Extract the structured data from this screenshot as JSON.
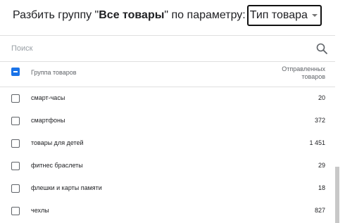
{
  "header": {
    "prefix": "Разбить группу \"",
    "group": "Все товары",
    "suffix": "\" по параметру:",
    "dropdown_value": "Тип товара"
  },
  "search": {
    "placeholder": "Поиск"
  },
  "table": {
    "col_name": "Группа товаров",
    "col_value": "Отправленных\nтоваров",
    "rows": [
      {
        "name": "смарт-часы",
        "value": "20"
      },
      {
        "name": "смартфоны",
        "value": "372"
      },
      {
        "name": "товары для детей",
        "value": "1 451"
      },
      {
        "name": "фитнес браслеты",
        "value": "29"
      },
      {
        "name": "флешки и карты памяти",
        "value": "18"
      },
      {
        "name": "чехлы",
        "value": "827"
      }
    ]
  },
  "icons": {
    "search": "search-icon",
    "dropdown": "chevron-down-icon"
  },
  "colors": {
    "accent": "#1a73e8"
  }
}
